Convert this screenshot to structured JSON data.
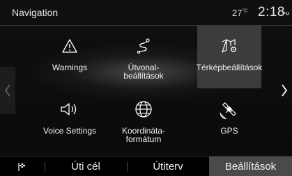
{
  "header": {
    "title": "Navigation",
    "temperature": "27",
    "temp_unit": "°C",
    "time": "2:18",
    "ampm": "PM"
  },
  "menu": [
    {
      "label": "Warnings",
      "icon": "warning-triangle-icon"
    },
    {
      "label": "Útvonal-\nbeállítások",
      "icon": "route-icon"
    },
    {
      "label": "Térképbeállítások",
      "icon": "map-settings-icon",
      "selected": true
    },
    {
      "label": "Voice Settings",
      "icon": "speaker-icon"
    },
    {
      "label": "Koordináta-\nformátum",
      "icon": "globe-icon"
    },
    {
      "label": "GPS",
      "icon": "satellite-icon"
    }
  ],
  "nav_arrows": {
    "left": "chevron-left-icon",
    "right": "chevron-right-icon"
  },
  "bottom_tabs": [
    {
      "label": "",
      "icon": "flag-icon"
    },
    {
      "label": "Úti cél"
    },
    {
      "label": "Útiterv"
    },
    {
      "label": "Beállítások",
      "active": true
    }
  ],
  "colors": {
    "background": "#0c0c0c",
    "selected_tile": "#3c3c3c",
    "active_tab": "#4a4a4a",
    "text": "#ffffff"
  }
}
